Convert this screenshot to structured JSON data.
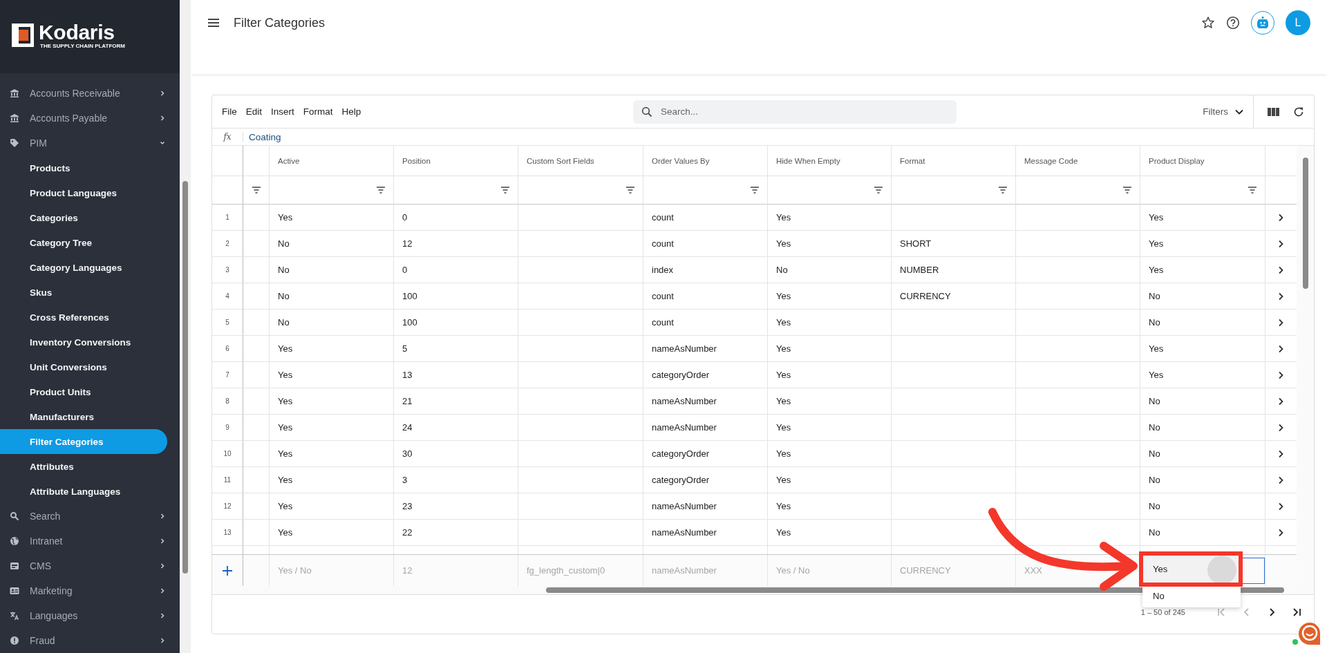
{
  "sidebar": {
    "logo": {
      "name": "Kodaris",
      "tagline": "THE SUPPLY CHAIN PLATFORM"
    },
    "items": [
      {
        "label": "Accounts Receivable",
        "expanded": false
      },
      {
        "label": "Accounts Payable",
        "expanded": false
      },
      {
        "label": "PIM",
        "expanded": true,
        "children": [
          {
            "label": "Products",
            "selected": false
          },
          {
            "label": "Product Languages",
            "selected": false
          },
          {
            "label": "Categories",
            "selected": false
          },
          {
            "label": "Category Tree",
            "selected": false
          },
          {
            "label": "Category Languages",
            "selected": false
          },
          {
            "label": "Skus",
            "selected": false
          },
          {
            "label": "Cross References",
            "selected": false
          },
          {
            "label": "Inventory Conversions",
            "selected": false
          },
          {
            "label": "Unit Conversions",
            "selected": false
          },
          {
            "label": "Product Units",
            "selected": false
          },
          {
            "label": "Manufacturers",
            "selected": false
          },
          {
            "label": "Filter Categories",
            "selected": true
          },
          {
            "label": "Attributes",
            "selected": false
          },
          {
            "label": "Attribute Languages",
            "selected": false
          }
        ]
      },
      {
        "label": "Search",
        "expanded": false
      },
      {
        "label": "Intranet",
        "expanded": false
      },
      {
        "label": "CMS",
        "expanded": false
      },
      {
        "label": "Marketing",
        "expanded": false
      },
      {
        "label": "Languages",
        "expanded": false
      },
      {
        "label": "Fraud",
        "expanded": false
      }
    ]
  },
  "header": {
    "title": "Filter Categories",
    "avatar": "L"
  },
  "grid": {
    "menu": [
      "File",
      "Edit",
      "Insert",
      "Format",
      "Help"
    ],
    "search": {
      "placeholder": "Search..."
    },
    "filters": "Filters",
    "formula": {
      "label": "fx",
      "value": "Coating"
    },
    "columns": [
      "Active",
      "Position",
      "Custom Sort Fields",
      "Order Values By",
      "Hide When Empty",
      "Format",
      "Message Code",
      "Product Display"
    ],
    "rows": [
      {
        "number": "1",
        "cells": [
          "Yes",
          "0",
          null,
          "count",
          "Yes",
          null,
          null,
          "Yes"
        ]
      },
      {
        "number": "2",
        "cells": [
          "No",
          "12",
          null,
          "count",
          "Yes",
          "SHORT",
          null,
          "Yes"
        ]
      },
      {
        "number": "3",
        "cells": [
          "No",
          "0",
          null,
          "index",
          "No",
          "NUMBER",
          null,
          "Yes"
        ]
      },
      {
        "number": "4",
        "cells": [
          "No",
          "100",
          null,
          "count",
          "Yes",
          "CURRENCY",
          null,
          "No"
        ]
      },
      {
        "number": "5",
        "cells": [
          "No",
          "100",
          null,
          "count",
          "Yes",
          null,
          null,
          "No"
        ]
      },
      {
        "number": "6",
        "cells": [
          "Yes",
          "5",
          null,
          "nameAsNumber",
          "Yes",
          null,
          null,
          "Yes"
        ]
      },
      {
        "number": "7",
        "cells": [
          "Yes",
          "13",
          null,
          "categoryOrder",
          "Yes",
          null,
          null,
          "Yes"
        ]
      },
      {
        "number": "8",
        "cells": [
          "Yes",
          "21",
          null,
          "nameAsNumber",
          "Yes",
          null,
          null,
          "No"
        ]
      },
      {
        "number": "9",
        "cells": [
          "Yes",
          "24",
          null,
          "nameAsNumber",
          "Yes",
          null,
          null,
          "No"
        ]
      },
      {
        "number": "10",
        "cells": [
          "Yes",
          "30",
          null,
          "categoryOrder",
          "Yes",
          null,
          null,
          "No"
        ]
      },
      {
        "number": "11",
        "cells": [
          "Yes",
          "3",
          null,
          "categoryOrder",
          "Yes",
          null,
          null,
          "No"
        ]
      },
      {
        "number": "12",
        "cells": [
          "Yes",
          "23",
          null,
          "nameAsNumber",
          "Yes",
          null,
          null,
          "No"
        ]
      },
      {
        "number": "13",
        "cells": [
          "Yes",
          "22",
          null,
          "nameAsNumber",
          "Yes",
          null,
          null,
          "No"
        ]
      }
    ],
    "new_row": {
      "placeholders": [
        "Yes / No",
        "12",
        "fg_length_custom|0",
        "nameAsNumber",
        "Yes / No",
        "CURRENCY",
        "XXX"
      ]
    },
    "dropdown": {
      "options": [
        {
          "label": "Yes",
          "selected": true
        },
        {
          "label": "No",
          "selected": false
        }
      ]
    },
    "pagination": {
      "range": "1 – 50 of 245",
      "buttons": [
        {
          "disabled": true
        },
        {
          "disabled": true
        },
        {
          "disabled": false
        },
        {
          "disabled": false
        }
      ]
    }
  }
}
